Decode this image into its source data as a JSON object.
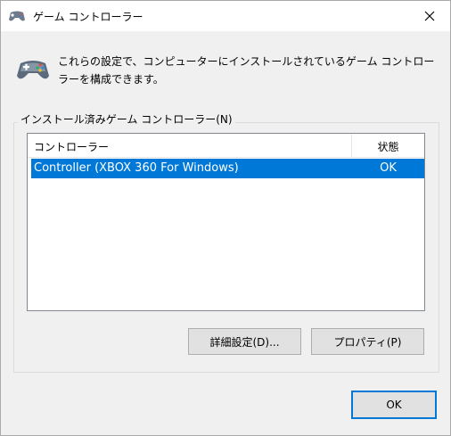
{
  "window": {
    "title": "ゲーム コントローラー"
  },
  "description": "これらの設定で、コンピューターにインストールされているゲーム コントローラーを構成できます。",
  "group": {
    "label": "インストール済みゲーム コントローラー(N)"
  },
  "list": {
    "columns": [
      "コントローラー",
      "状態"
    ],
    "rows": [
      {
        "name": "Controller (XBOX 360 For Windows)",
        "status": "OK",
        "selected": true
      }
    ]
  },
  "buttons": {
    "advanced": "詳細設定(D)...",
    "properties": "プロパティ(P)",
    "ok": "OK"
  },
  "icons": {
    "title_icon": "game-controller-icon",
    "description_icon": "game-controller-icon",
    "close_icon": "close-icon"
  },
  "colors": {
    "selection": "#0078d7",
    "default_button_border": "#0078d7"
  }
}
